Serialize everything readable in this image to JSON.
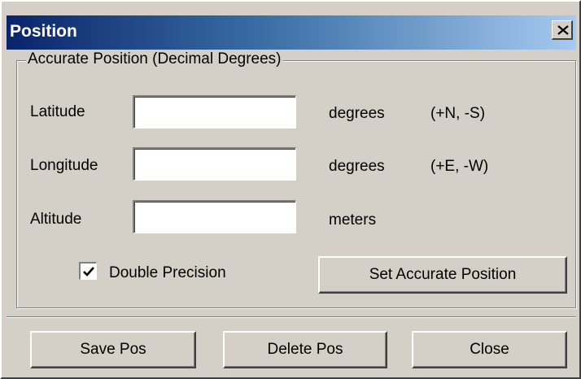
{
  "window": {
    "title": "Position",
    "close_glyph": "X"
  },
  "group": {
    "title": "Accurate Position (Decimal Degrees)"
  },
  "fields": {
    "latitude": {
      "label": "Latitude",
      "value": "",
      "unit": "degrees",
      "hint": "(+N, -S)"
    },
    "longitude": {
      "label": "Longitude",
      "value": "",
      "unit": "degrees",
      "hint": "(+E, -W)"
    },
    "altitude": {
      "label": "Altitude",
      "value": "",
      "unit": "meters",
      "hint": ""
    }
  },
  "double_precision": {
    "label": "Double Precision",
    "checked": true
  },
  "buttons": {
    "set_accurate": "Set Accurate Position",
    "save": "Save Pos",
    "delete": "Delete  Pos",
    "close": "Close"
  },
  "colors": {
    "face": "#d4d0c8",
    "title_start": "#0a246a",
    "title_end": "#a6caf0"
  }
}
